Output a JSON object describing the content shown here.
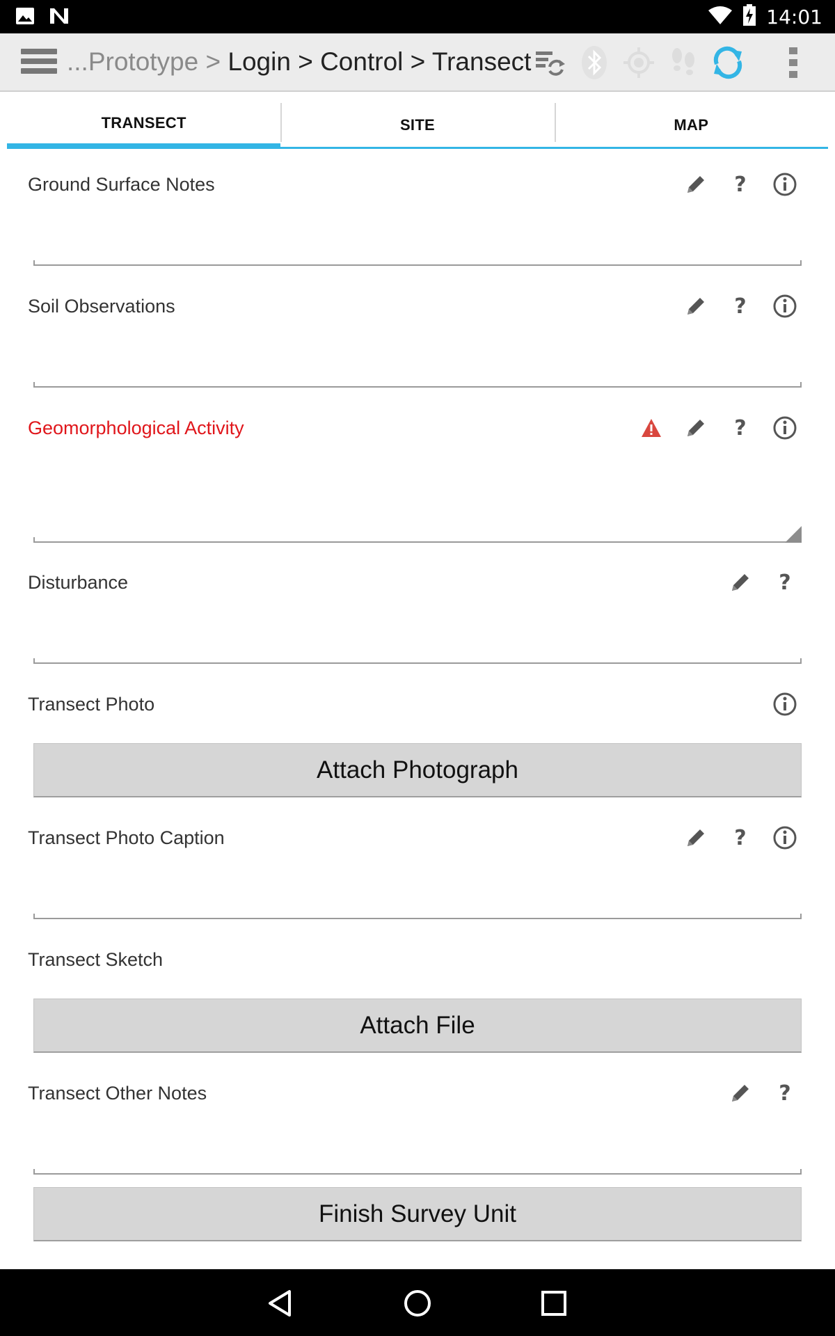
{
  "status_bar": {
    "time": "14:01",
    "left_icons": [
      "image-icon",
      "n-logo-icon"
    ],
    "right_icons": [
      "wifi-icon",
      "battery-charging-icon"
    ]
  },
  "action_bar": {
    "breadcrumb_dim": "...Prototype > ",
    "breadcrumb_main": "Login > Control > Transect",
    "icons": [
      "sync-settings-icon",
      "bluetooth-icon",
      "gps-icon",
      "footsteps-icon",
      "refresh-icon",
      "overflow-menu-icon"
    ],
    "accent": "#33b5e5"
  },
  "tabs": [
    {
      "label": "TRANSECT",
      "active": true
    },
    {
      "label": "SITE",
      "active": false
    },
    {
      "label": "MAP",
      "active": false
    }
  ],
  "form": {
    "ground_surface_notes": {
      "label": "Ground Surface Notes",
      "value": ""
    },
    "soil_observations": {
      "label": "Soil Observations",
      "value": ""
    },
    "geomorphological_activity": {
      "label": "Geomorphological Activity",
      "value": "",
      "error": true,
      "error_color": "#e0161b"
    },
    "disturbance": {
      "label": "Disturbance",
      "value": ""
    },
    "transect_photo": {
      "label": "Transect Photo",
      "button": "Attach Photograph"
    },
    "transect_photo_caption": {
      "label": "Transect Photo Caption",
      "value": ""
    },
    "transect_sketch": {
      "label": "Transect Sketch",
      "button": "Attach File"
    },
    "transect_other_notes": {
      "label": "Transect Other Notes",
      "value": ""
    },
    "finish_button": "Finish Survey Unit",
    "help_glyph": "?"
  },
  "nav_bar": {
    "icons": [
      "back-icon",
      "home-icon",
      "recents-icon"
    ]
  }
}
